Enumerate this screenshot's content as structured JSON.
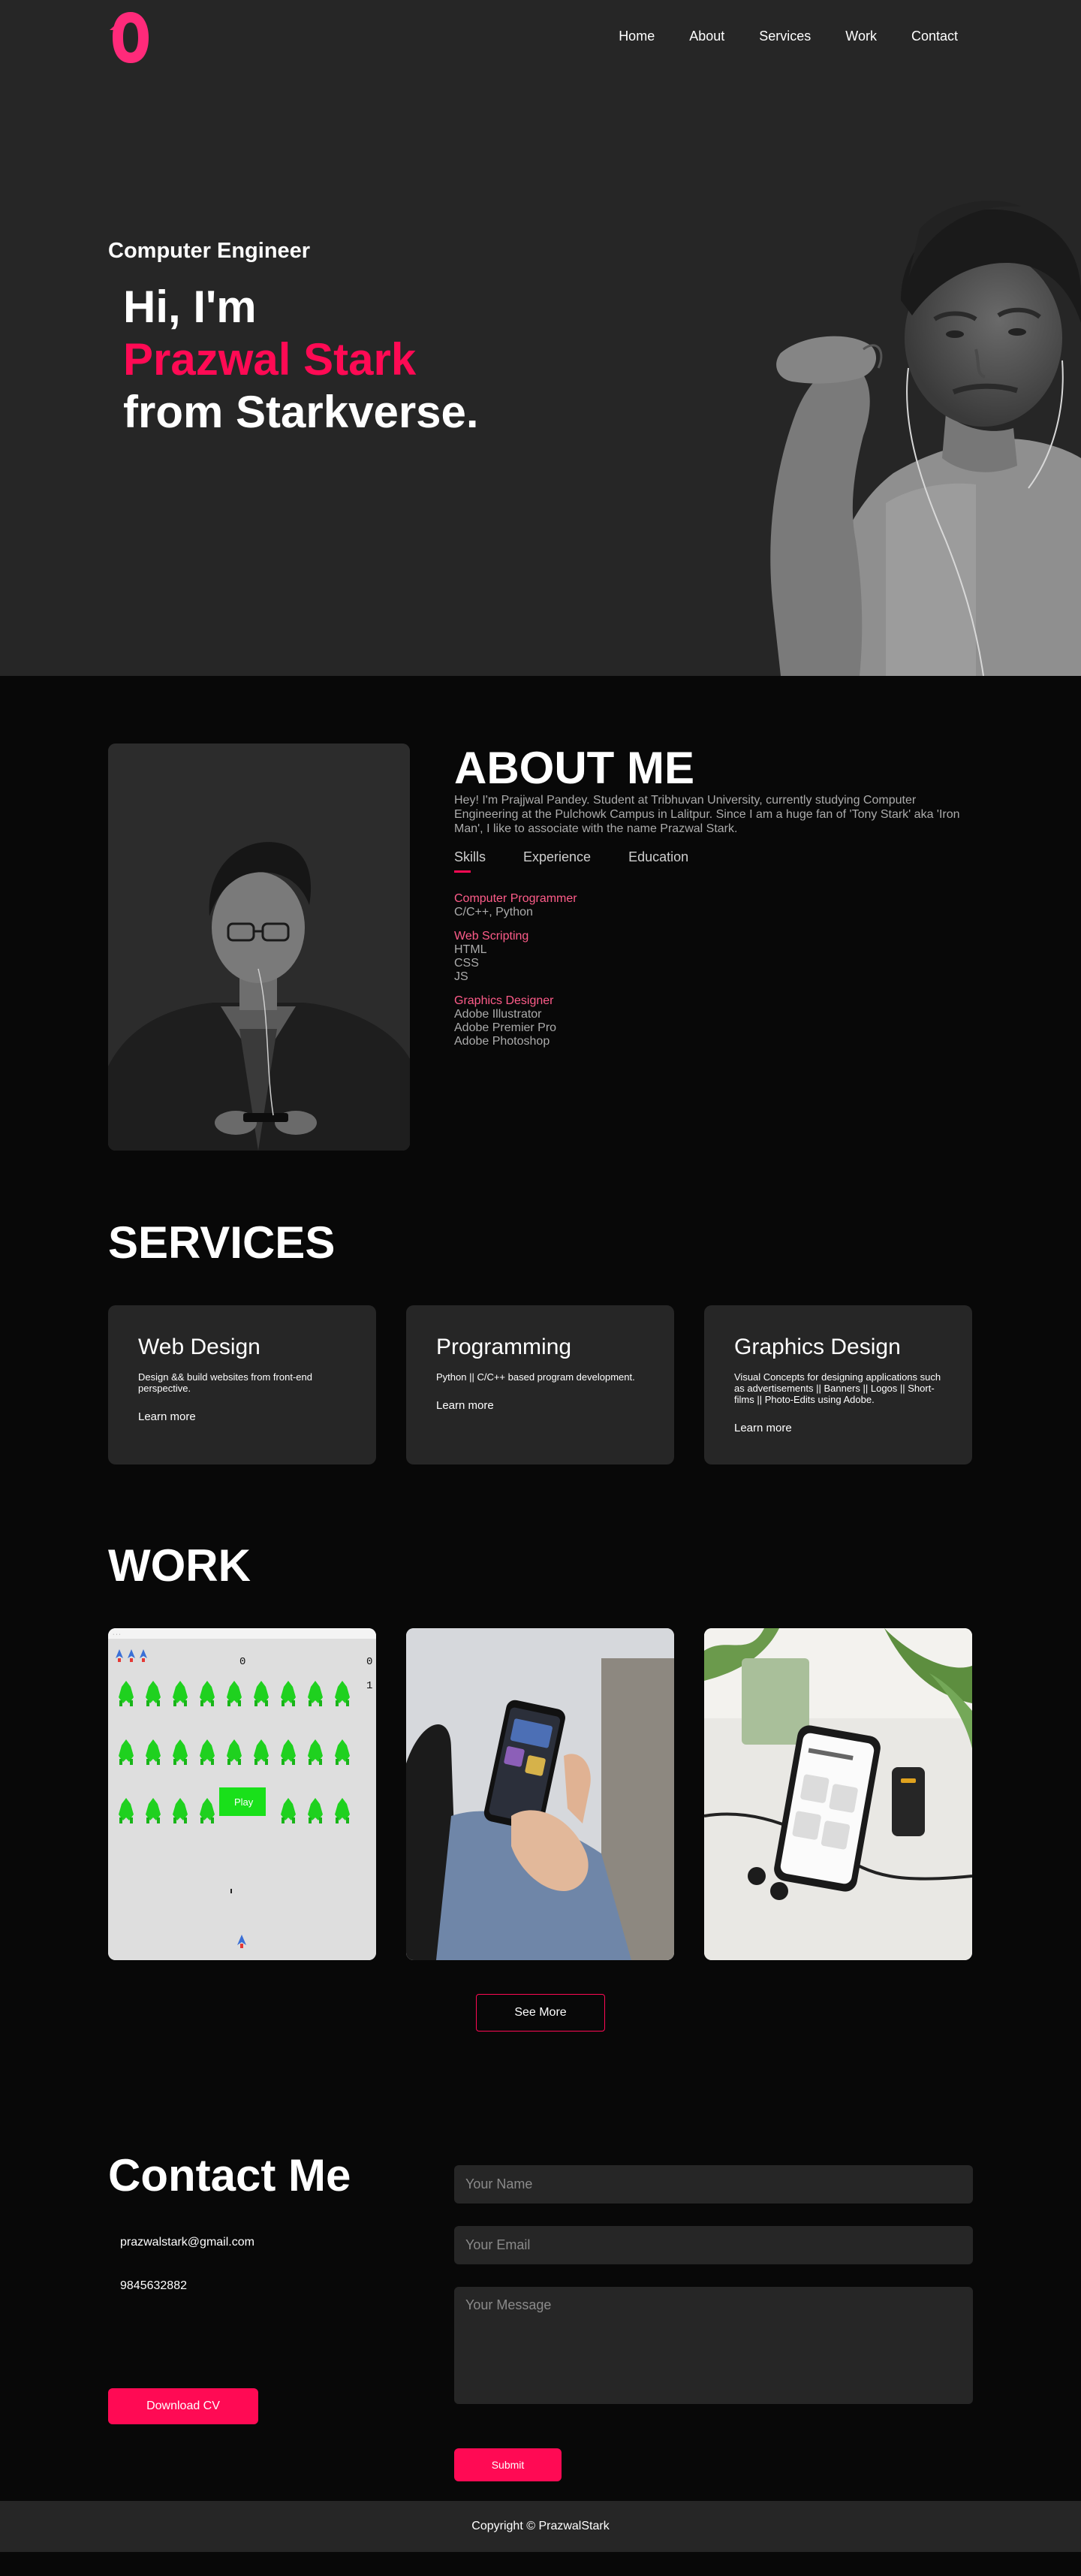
{
  "nav": {
    "links": [
      "Home",
      "About",
      "Services",
      "Work",
      "Contact"
    ]
  },
  "hero": {
    "subtitle": "Computer Engineer",
    "line1": "Hi, I'm",
    "name": "Prazwal Stark",
    "line3": "from Starkverse."
  },
  "about": {
    "title": "ABOUT ME",
    "text": "Hey! I'm Prajjwal Pandey. Student at Tribhuvan University, currently studying Computer Engineering at the Pulchowk Campus in Lalitpur. Since I am a huge fan of 'Tony Stark' aka 'Iron Man', I like to associate with the name Prazwal Stark.",
    "tabs": [
      "Skills",
      "Experience",
      "Education"
    ],
    "skills": [
      {
        "head": "Computer Programmer",
        "items": [
          "C/C++, Python"
        ]
      },
      {
        "head": "Web Scripting",
        "items": [
          "HTML",
          "CSS",
          "JS"
        ]
      },
      {
        "head": "Graphics Designer",
        "items": [
          "Adobe Illustrator",
          "Adobe Premier Pro",
          "Adobe Photoshop"
        ]
      }
    ]
  },
  "services": {
    "title": "SERVICES",
    "cards": [
      {
        "title": "Web Design",
        "desc": "Design && build websites from front-end perspective.",
        "link": "Learn more"
      },
      {
        "title": "Programming",
        "desc": "Python || C/C++ based program development.",
        "link": "Learn more"
      },
      {
        "title": "Graphics Design",
        "desc": "Visual Concepts for designing applications such as advertisements || Banners || Logos || Short-films || Photo-Edits using Adobe.",
        "link": "Learn more"
      }
    ]
  },
  "work": {
    "title": "WORK",
    "see_more": "See More",
    "game_score_left": "0",
    "game_score_right": "0",
    "game_lives": "1",
    "game_play": "Play"
  },
  "contact": {
    "title": "Contact Me",
    "email": "prazwalstark@gmail.com",
    "phone": "9845632882",
    "download": "Download CV",
    "name_placeholder": "Your Name",
    "email_placeholder": "Your Email",
    "message_placeholder": "Your Message",
    "submit": "Submit"
  },
  "footer": {
    "copyright": "Copyright © PrazwalStark"
  },
  "colors": {
    "accent": "#ff0a54",
    "surface": "#262626",
    "background": "#080808"
  }
}
